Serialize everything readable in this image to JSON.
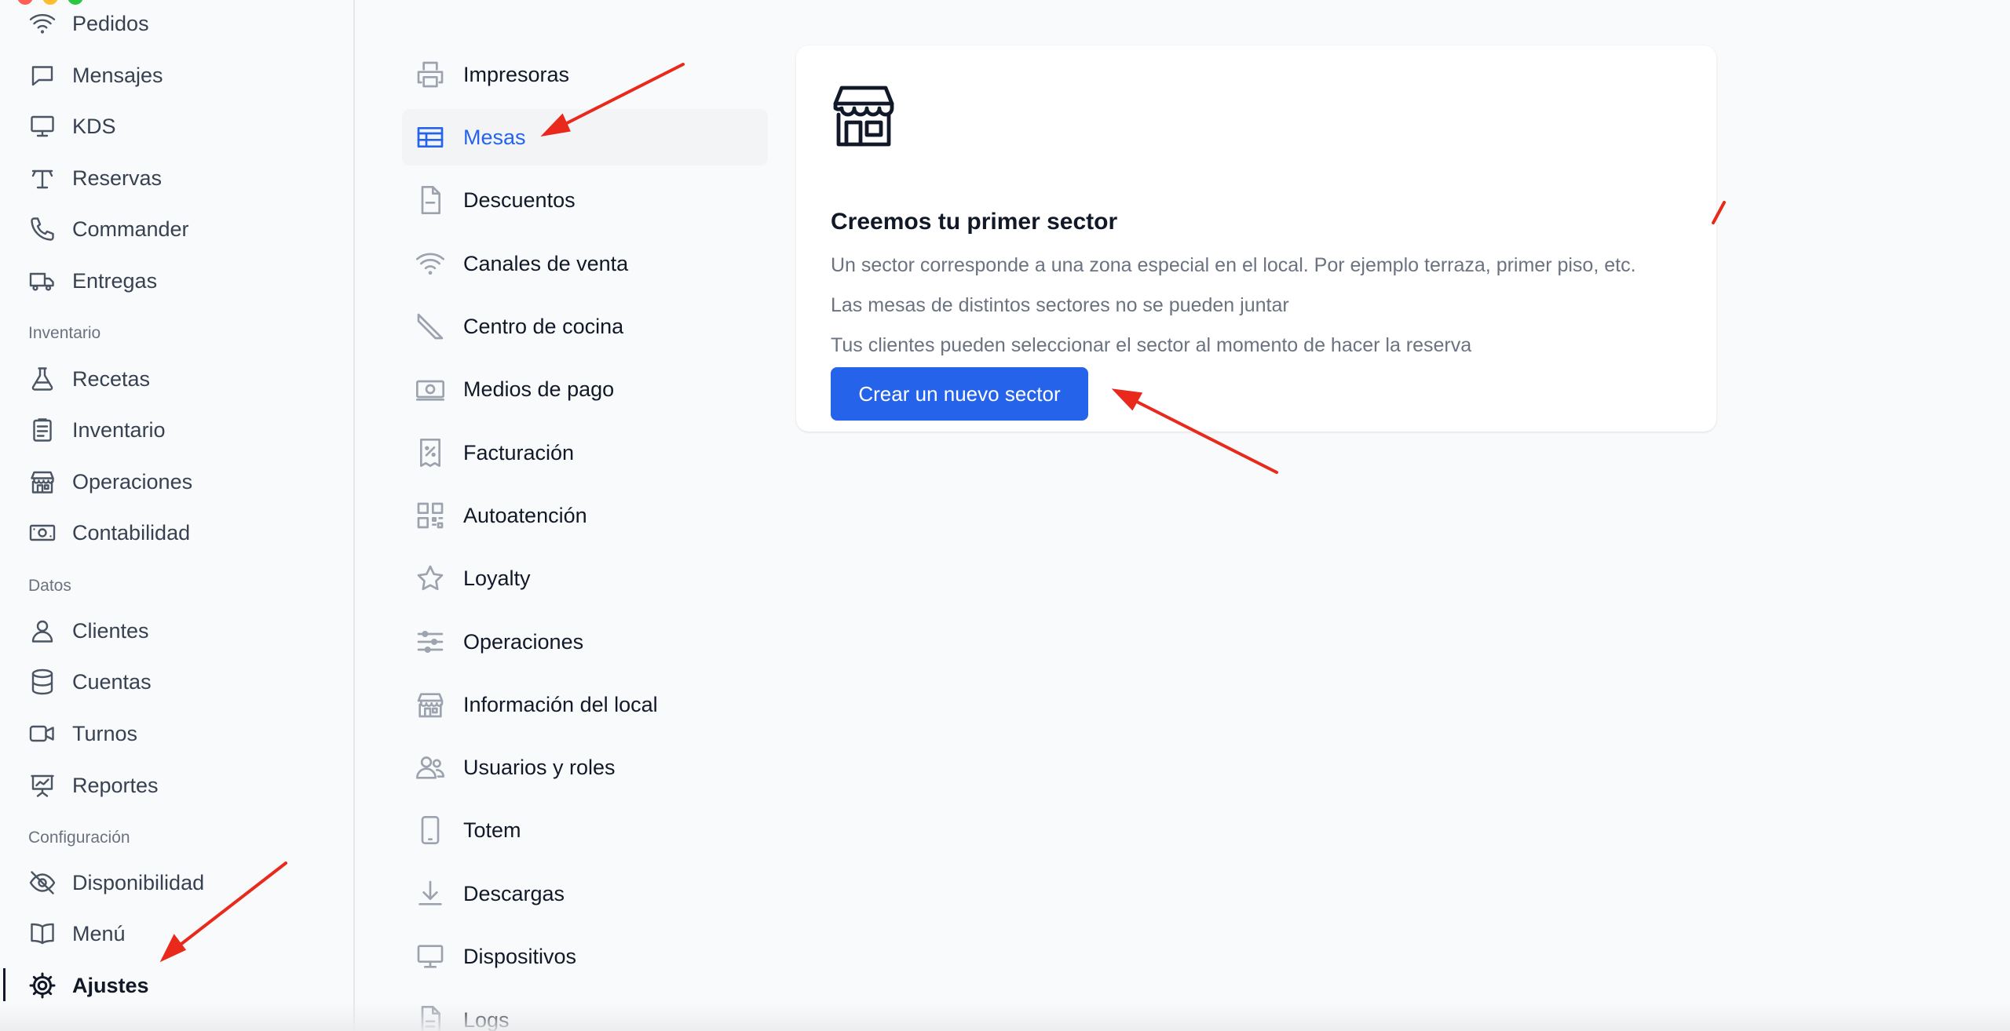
{
  "window": {
    "traffic_lights": [
      "#ff5f57",
      "#febc2e",
      "#28c840"
    ]
  },
  "sidebar": {
    "items_top": [
      {
        "id": "pedidos",
        "label": "Pedidos",
        "icon": "wifi-icon"
      },
      {
        "id": "mensajes",
        "label": "Mensajes",
        "icon": "chat-bubble-icon"
      },
      {
        "id": "kds",
        "label": "KDS",
        "icon": "monitor-icon"
      },
      {
        "id": "reservas",
        "label": "Reservas",
        "icon": "table-icon"
      },
      {
        "id": "commander",
        "label": "Commander",
        "icon": "phone-icon"
      },
      {
        "id": "entregas",
        "label": "Entregas",
        "icon": "truck-icon"
      }
    ],
    "section_inventario": "Inventario",
    "items_inventario": [
      {
        "id": "recetas",
        "label": "Recetas",
        "icon": "beaker-icon"
      },
      {
        "id": "inventario",
        "label": "Inventario",
        "icon": "clipboard-icon"
      },
      {
        "id": "operaciones",
        "label": "Operaciones",
        "icon": "store-icon"
      },
      {
        "id": "contabilidad",
        "label": "Contabilidad",
        "icon": "banknote-icon"
      }
    ],
    "section_datos": "Datos",
    "items_datos": [
      {
        "id": "clientes",
        "label": "Clientes",
        "icon": "user-icon"
      },
      {
        "id": "cuentas",
        "label": "Cuentas",
        "icon": "database-icon"
      },
      {
        "id": "turnos",
        "label": "Turnos",
        "icon": "video-camera-icon"
      },
      {
        "id": "reportes",
        "label": "Reportes",
        "icon": "presentation-chart-icon"
      }
    ],
    "section_config": "Configuración",
    "items_config": [
      {
        "id": "disponibilidad",
        "label": "Disponibilidad",
        "icon": "eye-slash-icon"
      },
      {
        "id": "menu",
        "label": "Menú",
        "icon": "book-open-icon"
      },
      {
        "id": "ajustes",
        "label": "Ajustes",
        "icon": "cog-icon",
        "active": true
      }
    ]
  },
  "settings_menu": {
    "active": "Mesas",
    "items": [
      {
        "label": "Impresoras",
        "icon": "printer-icon"
      },
      {
        "label": "Mesas",
        "icon": "table-cells-icon"
      },
      {
        "label": "Descuentos",
        "icon": "document-minus-icon"
      },
      {
        "label": "Canales de venta",
        "icon": "wifi-icon"
      },
      {
        "label": "Centro de cocina",
        "icon": "knife-icon"
      },
      {
        "label": "Medios de pago",
        "icon": "banknote-icon"
      },
      {
        "label": "Facturación",
        "icon": "receipt-percent-icon"
      },
      {
        "label": "Autoatención",
        "icon": "qr-code-icon"
      },
      {
        "label": "Loyalty",
        "icon": "star-icon"
      },
      {
        "label": "Operaciones",
        "icon": "adjustments-icon"
      },
      {
        "label": "Información del local",
        "icon": "store-icon"
      },
      {
        "label": "Usuarios y roles",
        "icon": "users-icon"
      },
      {
        "label": "Totem",
        "icon": "tablet-icon"
      },
      {
        "label": "Descargas",
        "icon": "download-icon"
      },
      {
        "label": "Dispositivos",
        "icon": "computer-desktop-icon"
      },
      {
        "label": "Logs",
        "icon": "document-text-icon"
      }
    ]
  },
  "empty_state": {
    "icon": "store-icon",
    "title": "Creemos tu primer sector",
    "lines": [
      "Un sector corresponde a una zona especial en el local. Por ejemplo terraza, primer piso, etc.",
      "Las mesas de distintos sectores no se pueden juntar",
      "Tus clientes pueden seleccionar el sector al momento de hacer la reserva"
    ],
    "button_label": "Crear un nuevo sector"
  },
  "colors": {
    "accent": "#2563eb",
    "annotation": "#e8291c"
  }
}
